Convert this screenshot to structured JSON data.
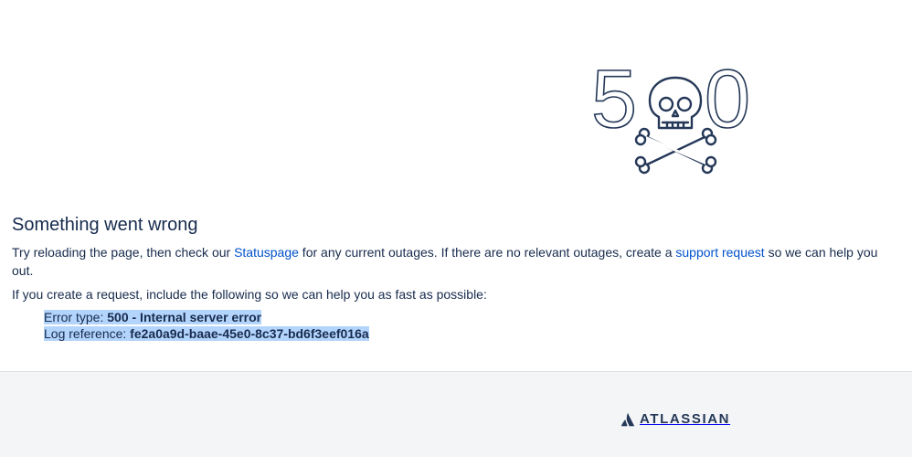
{
  "illustration": {
    "digit_left": "5",
    "digit_right": "0",
    "icon": "skull-crossbones-icon"
  },
  "heading": "Something went wrong",
  "paragraph1": {
    "before": "Try reloading the page, then check our ",
    "link1": "Statuspage",
    "middle": " for any current outages. If there are no relevant outages, create a ",
    "link2": "support request",
    "after": " so we can help you out."
  },
  "paragraph2": "If you create a request, include the following so we can help you as fast as possible:",
  "details": {
    "error_type_label": "Error type: ",
    "error_type_value": "500 - Internal server error",
    "log_ref_label": "Log reference: ",
    "log_ref_value": "fe2a0a9d-baae-45e0-8c37-bd6f3eef016a"
  },
  "footer": {
    "logo_text": "ATLASSIAN",
    "logo_icon": "atlassian-logo-icon"
  },
  "colors": {
    "text": "#172b4d",
    "link": "#0052cc",
    "selection": "#b3d4fc",
    "footer_bg": "#f4f5f7",
    "logo": "#253858"
  }
}
